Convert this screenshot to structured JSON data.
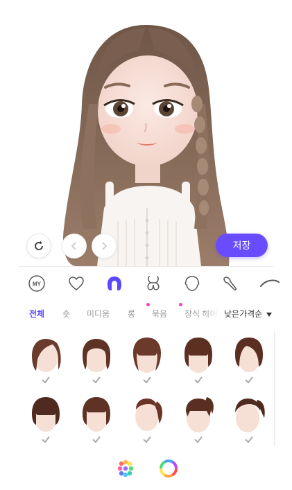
{
  "preview": {
    "save_label": "저장",
    "colors": {
      "accent": "#6a4cff",
      "hair": "#8a6a58"
    },
    "buttons": [
      "refresh-icon",
      "chevron-left-icon",
      "chevron-right-icon"
    ]
  },
  "categories": [
    {
      "icon": "my-icon",
      "text": "MY",
      "active": false
    },
    {
      "icon": "heart-icon",
      "active": false
    },
    {
      "icon": "hair-icon",
      "active": true
    },
    {
      "icon": "bow-icon",
      "active": false
    },
    {
      "icon": "face-shape-icon",
      "active": false
    },
    {
      "icon": "brush-icon",
      "active": false
    },
    {
      "icon": "eyebrow-icon",
      "active": false
    }
  ],
  "subtabs": [
    {
      "label": "전체",
      "active": true
    },
    {
      "label": "숏",
      "active": false
    },
    {
      "label": "미디움",
      "active": false
    },
    {
      "label": "롱",
      "active": false
    },
    {
      "label": "묶음",
      "active": false,
      "new": true
    },
    {
      "label": "장식 헤어",
      "active": false,
      "new": true
    }
  ],
  "sort": {
    "label": "낮은가격순",
    "icon": "caret-down-icon"
  },
  "hair_items": [
    {
      "style": "short-side-part",
      "owned": true
    },
    {
      "style": "short-wavy",
      "owned": true
    },
    {
      "style": "bangs-wavy",
      "owned": true
    },
    {
      "style": "bob-bangs",
      "owned": true
    },
    {
      "style": "bob",
      "owned": true
    },
    {
      "style": "bob-bangs-dark",
      "owned": true
    },
    {
      "style": "bob-short-bangs",
      "owned": true
    },
    {
      "style": "ponytail",
      "owned": true
    },
    {
      "style": "ponytail-bangs",
      "owned": true
    },
    {
      "style": "side-ponytail",
      "owned": true
    }
  ],
  "bottom_tools": [
    "palette-icon",
    "color-ring-icon"
  ]
}
